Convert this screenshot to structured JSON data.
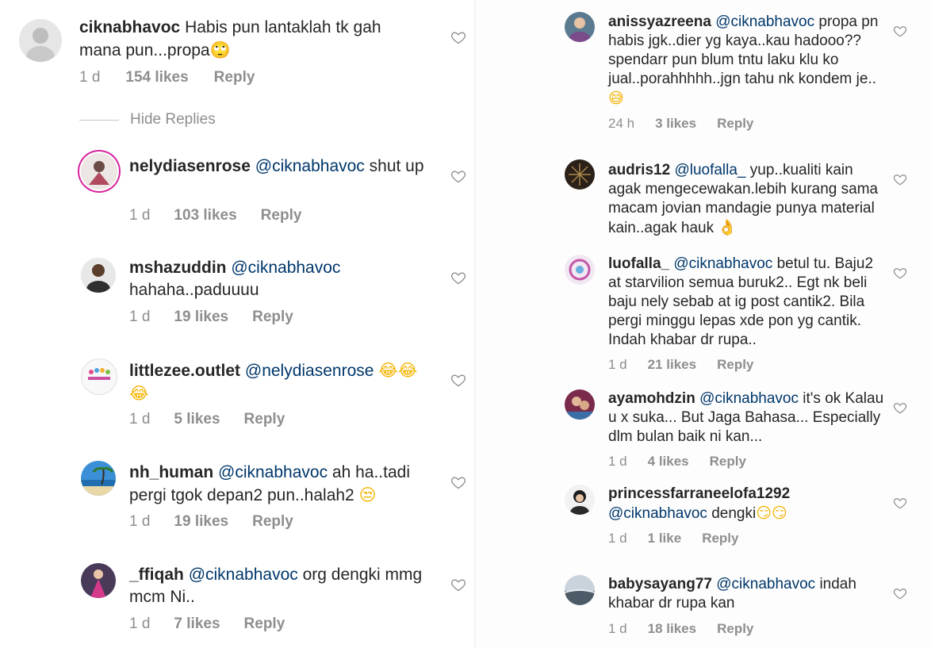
{
  "left": {
    "main_comment": {
      "username": "ciknabhavoc",
      "text": "Habis pun lantaklah tk gah mana pun...propa",
      "emoji": "🙄",
      "time": "1 d",
      "likes": "154 likes",
      "reply": "Reply"
    },
    "hide_replies": "Hide Replies",
    "replies": [
      {
        "username": "nelydiasenrose",
        "mention": "@ciknabhavoc",
        "text": "shut up",
        "time": "1 d",
        "likes": "103 likes",
        "reply": "Reply"
      },
      {
        "username": "mshazuddin",
        "mention": "@ciknabhavoc",
        "text": "hahaha..paduuuu",
        "time": "1 d",
        "likes": "19 likes",
        "reply": "Reply"
      },
      {
        "username": "littlezee.outlet",
        "mention": "@nelydiasenrose",
        "text": "",
        "emoji": "😂😂😂",
        "time": "1 d",
        "likes": "5 likes",
        "reply": "Reply"
      },
      {
        "username": "nh_human",
        "mention": "@ciknabhavoc",
        "text": "ah ha..tadi pergi tgok depan2 pun..halah2",
        "emoji": "😒",
        "time": "1 d",
        "likes": "19 likes",
        "reply": "Reply"
      },
      {
        "username": "_ffiqah",
        "mention": "@ciknabhavoc",
        "text": "org dengki mmg mcm Ni..",
        "time": "1 d",
        "likes": "7 likes",
        "reply": "Reply"
      }
    ]
  },
  "right": {
    "comments": [
      {
        "username": "anissyazreena",
        "mention": "@ciknabhavoc",
        "text": "propa pn habis jgk..dier yg kaya..kau hadooo??spendarr pun blum tntu laku klu ko jual..porahhhhh..jgn tahu nk kondem je..",
        "emoji": "😅",
        "time": "24 h",
        "likes": "3 likes",
        "reply": "Reply"
      },
      {
        "username": "audris12",
        "mention": "@luofalla_",
        "text": "yup..kualiti kain agak mengecewakan.lebih kurang sama macam jovian mandagie punya material kain..agak hauk",
        "emoji": "👌",
        "time": "",
        "likes": "",
        "reply": ""
      },
      {
        "username": "luofalla_",
        "mention": "@ciknabhavoc",
        "text": "betul tu. Baju2 at starvilion semua buruk2.. Egt nk beli baju nely sebab at ig post cantik2. Bila pergi minggu lepas xde pon yg cantik. Indah khabar dr rupa..",
        "time": "1 d",
        "likes": "21 likes",
        "reply": "Reply"
      },
      {
        "username": "ayamohdzin",
        "mention": "@ciknabhavoc",
        "text": "it's ok Kalau u x suka... But Jaga Bahasa... Especially dlm bulan baik ni kan...",
        "time": "1 d",
        "likes": "4 likes",
        "reply": "Reply"
      },
      {
        "username": "princessfarraneelofa1292",
        "mention": "@ciknabhavoc",
        "text": "dengki",
        "emoji": "😏😏",
        "time": "1 d",
        "likes": "1 like",
        "reply": "Reply"
      },
      {
        "username": "babysayang77",
        "mention": "@ciknabhavoc",
        "text": "indah khabar dr rupa kan",
        "time": "1 d",
        "likes": "18 likes",
        "reply": "Reply"
      }
    ]
  },
  "colors": {
    "username": "#262626",
    "mention": "#00376b",
    "meta": "#8e8e8e",
    "story_ring": "#d6249f"
  },
  "icons": [
    "heart-outline-icon"
  ]
}
